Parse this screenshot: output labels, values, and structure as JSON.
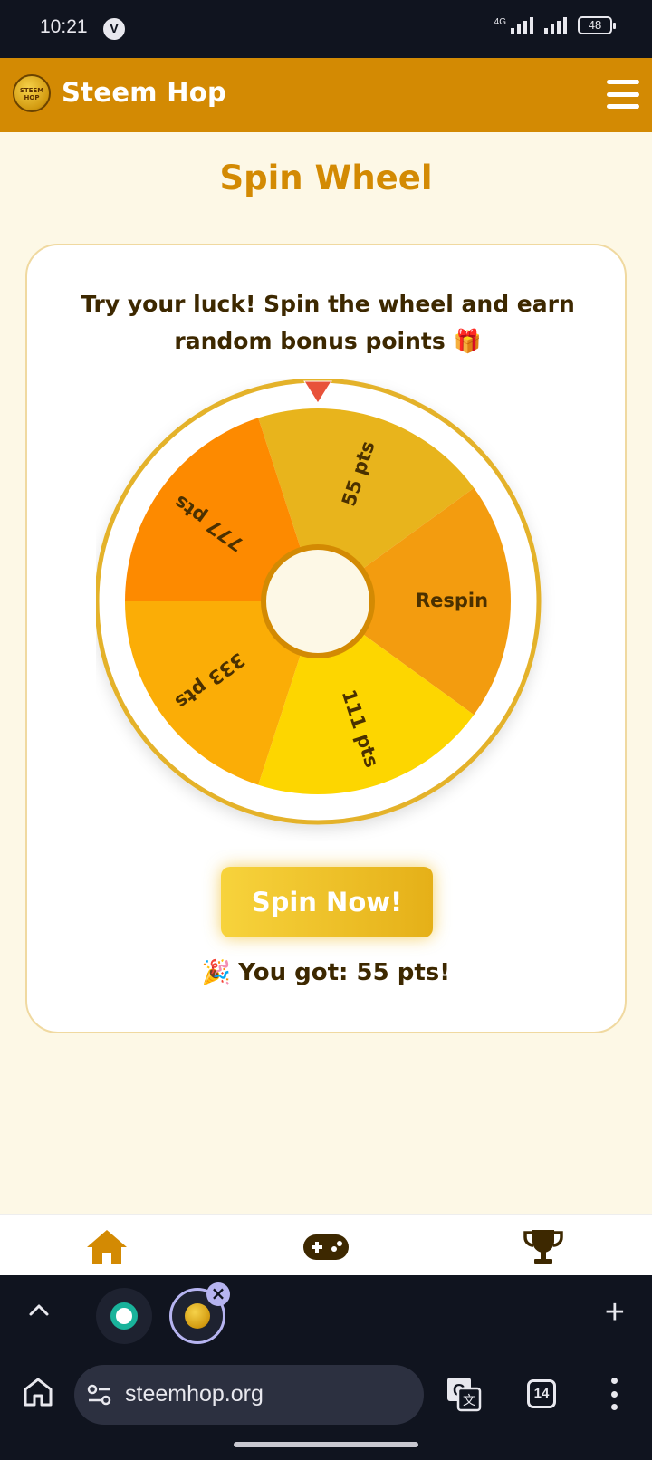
{
  "status_bar": {
    "time": "10:21",
    "network": "4G",
    "battery": "48"
  },
  "header": {
    "title": "Steem Hop",
    "logo_text": "STEEM HOP"
  },
  "page": {
    "title": "Spin Wheel",
    "intro_line1": "Try your luck! Spin the wheel and earn",
    "intro_line2": "random bonus points 🎁",
    "wheel": {
      "segments": [
        {
          "label": "55 pts",
          "color": "#e8b41c"
        },
        {
          "label": "Respin",
          "color": "#f39c0f"
        },
        {
          "label": "111 pts",
          "color": "#fdd600"
        },
        {
          "label": "333 pts",
          "color": "#fbad06"
        },
        {
          "label": "777 pts",
          "color": "#fd8a00"
        }
      ],
      "rim_color": "#e4b22a",
      "pointer_color": "#e8523a"
    },
    "spin_button": "Spin Now!",
    "result_emoji": "🎉",
    "result_text": "You got: 55 pts!"
  },
  "bottom_nav": {
    "items": [
      "home-icon",
      "gamepad-icon",
      "trophy-icon"
    ]
  },
  "browser": {
    "url": "steemhop.org",
    "tab_count": "14",
    "close_symbol": "×",
    "new_tab_symbol": "+"
  },
  "colors": {
    "brand": "#d38a03",
    "background": "#fdf8e6",
    "text_dark": "#3d2800"
  }
}
